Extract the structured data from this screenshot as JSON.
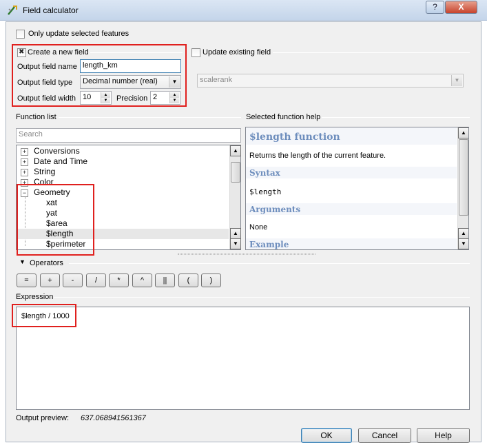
{
  "window": {
    "title": "Field calculator",
    "help_button": "?",
    "close_button": "X"
  },
  "options": {
    "only_selected_label": "Only update selected features",
    "create_new_field_label": "Create a new field",
    "create_new_field_checked": true,
    "update_existing_label": "Update existing field",
    "update_existing_checked": false
  },
  "new_field": {
    "name_label": "Output field name",
    "name_value": "length_km",
    "type_label": "Output field type",
    "type_value": "Decimal number (real)",
    "width_label": "Output field width",
    "width_value": "10",
    "precision_label": "Precision",
    "precision_value": "2"
  },
  "existing_field": {
    "selected": "scalerank"
  },
  "function_list": {
    "label": "Function list",
    "search_placeholder": "Search",
    "groups": [
      "Conversions",
      "Date and Time",
      "String",
      "Color",
      "Geometry"
    ],
    "geometry_children": [
      "xat",
      "yat",
      "$area",
      "$length",
      "$perimeter"
    ],
    "selected_item": "$length"
  },
  "function_help": {
    "label": "Selected function help",
    "title": "$length function",
    "description": "Returns the length of the current feature.",
    "syntax_heading": "Syntax",
    "syntax": "$length",
    "arguments_heading": "Arguments",
    "arguments": "None",
    "example_heading": "Example"
  },
  "operators": {
    "label": "Operators",
    "buttons": [
      "=",
      "+",
      "-",
      "/",
      "*",
      "^",
      "||",
      "(",
      ")"
    ]
  },
  "expression": {
    "label": "Expression",
    "value": "$length / 1000"
  },
  "preview": {
    "label": "Output preview:",
    "value": "637.068941561367"
  },
  "buttons": {
    "ok": "OK",
    "cancel": "Cancel",
    "help": "Help"
  },
  "colors": {
    "highlight_box": "#e0201e",
    "help_heading": "#6e8ebd"
  }
}
